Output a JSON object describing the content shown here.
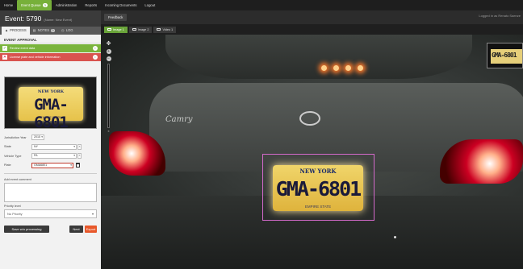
{
  "topnav": {
    "items": [
      {
        "label": "Home"
      },
      {
        "label": "Event Queue",
        "badge": "3"
      },
      {
        "label": "Administration"
      },
      {
        "label": "Reports"
      },
      {
        "label": "Incoming Documents"
      },
      {
        "label": "Logout"
      }
    ]
  },
  "event": {
    "title": "Event: 5790",
    "subtitle": "(Name: New Event)"
  },
  "tabs": [
    {
      "label": "PROCESS"
    },
    {
      "label": "NOTES",
      "count": "0"
    },
    {
      "label": "LOG"
    }
  ],
  "section_title": "EVENT APPROVAL",
  "steps": [
    {
      "label": "Review event data",
      "status": "done"
    },
    {
      "label": "License plate and vehicle information",
      "status": "error"
    }
  ],
  "thumbnail": {
    "state": "NEW YORK",
    "plate": "GMA-6801",
    "motto": "EMPIRE STATE"
  },
  "form": {
    "jurisdiction_label": "Jurisdiction Year",
    "jurisdiction_value": "2015",
    "state_label": "State",
    "state_value": "NY",
    "vehicle_type_label": "Vehicle Type",
    "vehicle_type_value": "PA",
    "plate_label": "Plate",
    "plate_value": "GMA6801",
    "comment_label": "Add event comment",
    "priority_label": "Priority level",
    "priority_value": "No Priority",
    "save_label": "Save w/o processing",
    "next_label": "Next",
    "export_label": "Export"
  },
  "toolbar": {
    "feedback_label": "Feedback",
    "logged_in": "Logged in as Renato Saenze",
    "event_link": "Event 6/1",
    "view_list": "View List",
    "return_btn": "Return to"
  },
  "image_tabs": [
    {
      "label": "Image 1",
      "active": true
    },
    {
      "label": "Image 2",
      "active": false
    },
    {
      "label": "Video 1",
      "active": false
    }
  ],
  "viewer": {
    "badge_text": "Camry",
    "plate_state": "NEW YORK",
    "plate": "GMA-6801",
    "plate_motto": "EMPIRE STATE",
    "inset_plate": "GMA-6801"
  },
  "colors": {
    "accent_green": "#77b03a",
    "error_red": "#d9534f",
    "export_orange": "#e8582a",
    "roi_magenta": "#d46acb"
  }
}
